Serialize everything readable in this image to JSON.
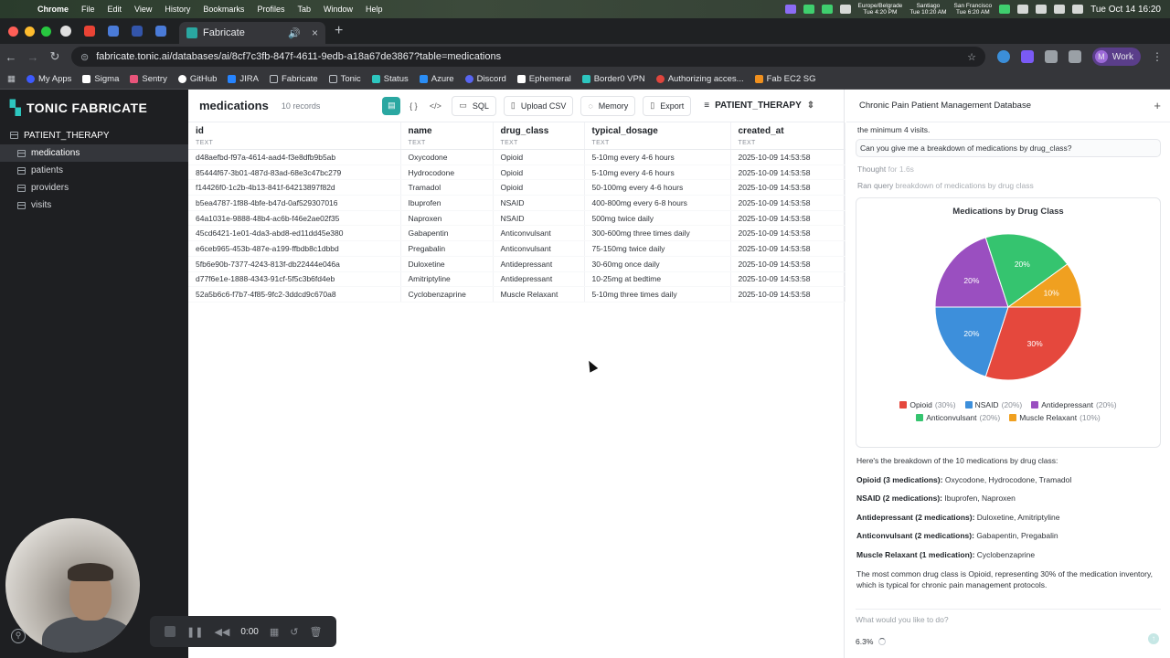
{
  "menubar": {
    "app": "Chrome",
    "items": [
      "File",
      "Edit",
      "View",
      "History",
      "Bookmarks",
      "Profiles",
      "Tab",
      "Window",
      "Help"
    ],
    "clocks": [
      {
        "city": "Europe/Belgrade",
        "time": "Tue 4:20 PM"
      },
      {
        "city": "Santiago",
        "time": "Tue 10:20 AM"
      },
      {
        "city": "San Francisco",
        "time": "Tue 6:20 AM"
      }
    ],
    "datetime": "Tue Oct 14  16:20"
  },
  "browser": {
    "active_tab": "Fabricate",
    "url": "fabricate.tonic.ai/databases/ai/8cf7c3fb-847f-4611-9edb-a18a67de3867?table=medications",
    "profile": "Work",
    "profile_initial": "M",
    "bookmarks": [
      "My Apps",
      "Sigma",
      "Sentry",
      "GitHub",
      "JIRA",
      "Fabricate",
      "Tonic",
      "Status",
      "Azure",
      "Discord",
      "Ephemeral",
      "Border0 VPN",
      "Authorizing acces...",
      "Fab EC2 SG"
    ]
  },
  "sidebar": {
    "brand": "TONIC FABRICATE",
    "database": "PATIENT_THERAPY",
    "tables": [
      {
        "label": "medications",
        "active": true
      },
      {
        "label": "patients",
        "active": false
      },
      {
        "label": "providers",
        "active": false
      },
      {
        "label": "visits",
        "active": false
      }
    ]
  },
  "toolbar": {
    "table_name": "medications",
    "record_count": "10 records",
    "sql": "SQL",
    "upload": "Upload CSV",
    "memory": "Memory",
    "export": "Export",
    "db_selector": "PATIENT_THERAPY"
  },
  "table": {
    "columns": [
      {
        "name": "id",
        "type": "TEXT"
      },
      {
        "name": "name",
        "type": "TEXT"
      },
      {
        "name": "drug_class",
        "type": "TEXT"
      },
      {
        "name": "typical_dosage",
        "type": "TEXT"
      },
      {
        "name": "created_at",
        "type": "TEXT"
      }
    ],
    "rows": [
      [
        "d48aefbd-f97a-4614-aad4-f3e8dfb9b5ab",
        "Oxycodone",
        "Opioid",
        "5-10mg every 4-6 hours",
        "2025-10-09 14:53:58"
      ],
      [
        "85444f67-3b01-487d-83ad-68e3c47bc279",
        "Hydrocodone",
        "Opioid",
        "5-10mg every 4-6 hours",
        "2025-10-09 14:53:58"
      ],
      [
        "f14426f0-1c2b-4b13-841f-64213897f82d",
        "Tramadol",
        "Opioid",
        "50-100mg every 4-6 hours",
        "2025-10-09 14:53:58"
      ],
      [
        "b5ea4787-1f88-4bfe-b47d-0af529307016",
        "Ibuprofen",
        "NSAID",
        "400-800mg every 6-8 hours",
        "2025-10-09 14:53:58"
      ],
      [
        "64a1031e-9888-48b4-ac6b-f46e2ae02f35",
        "Naproxen",
        "NSAID",
        "500mg twice daily",
        "2025-10-09 14:53:58"
      ],
      [
        "45cd6421-1e01-4da3-abd8-ed11dd45e380",
        "Gabapentin",
        "Anticonvulsant",
        "300-600mg three times daily",
        "2025-10-09 14:53:58"
      ],
      [
        "e6ceb965-453b-487e-a199-ffbdb8c1dbbd",
        "Pregabalin",
        "Anticonvulsant",
        "75-150mg twice daily",
        "2025-10-09 14:53:58"
      ],
      [
        "5fb6e90b-7377-4243-813f-db22444e046a",
        "Duloxetine",
        "Antidepressant",
        "30-60mg once daily",
        "2025-10-09 14:53:58"
      ],
      [
        "d77f6e1e-1888-4343-91cf-5f5c3b6fd4eb",
        "Amitriptyline",
        "Antidepressant",
        "10-25mg at bedtime",
        "2025-10-09 14:53:58"
      ],
      [
        "52a5b6c6-f7b7-4f85-9fc2-3ddcd9c670a8",
        "Cyclobenzaprine",
        "Muscle Relaxant",
        "5-10mg three times daily",
        "2025-10-09 14:53:58"
      ]
    ]
  },
  "chat": {
    "header": "Chronic Pain Patient Management Database",
    "prev_tail": "the minimum 4 visits.",
    "user_message": "Can you give me a breakdown of medications by drug_class?",
    "thought_label": "Thought",
    "thought_time": "for 1.6s",
    "ran_label": "Ran query",
    "ran_desc": "breakdown of medications by drug class",
    "answer_intro": "Here's the breakdown of the 10 medications by drug class:",
    "groups": [
      {
        "label": "Opioid (3 medications):",
        "items": "Oxycodone, Hydrocodone, Tramadol"
      },
      {
        "label": "NSAID (2 medications):",
        "items": "Ibuprofen, Naproxen"
      },
      {
        "label": "Antidepressant (2 medications):",
        "items": "Duloxetine, Amitriptyline"
      },
      {
        "label": "Anticonvulsant (2 medications):",
        "items": "Gabapentin, Pregabalin"
      },
      {
        "label": "Muscle Relaxant (1 medication):",
        "items": "Cyclobenzaprine"
      }
    ],
    "conclusion": "The most common drug class is Opioid, representing 30% of the medication inventory, which is typical for chronic pain management protocols.",
    "composer_placeholder": "What would you like to do?",
    "progress": "6.3%"
  },
  "chart_data": {
    "type": "pie",
    "title": "Medications by Drug Class",
    "slices": [
      {
        "label": "Opioid",
        "value": 30,
        "color": "#e5483d"
      },
      {
        "label": "NSAID",
        "value": 20,
        "color": "#3d8fdb"
      },
      {
        "label": "Antidepressant",
        "value": 20,
        "color": "#9a4fc0"
      },
      {
        "label": "Anticonvulsant",
        "value": 20,
        "color": "#35c46f"
      },
      {
        "label": "Muscle Relaxant",
        "value": 10,
        "color": "#f0a020"
      }
    ],
    "legend_pcts": [
      "(30%)",
      "(20%)",
      "(20%)",
      "(20%)",
      "(10%)"
    ],
    "slice_labels": [
      "30%",
      "20%",
      "20%",
      "20%",
      "10%"
    ],
    "legend": "bottom"
  },
  "recorder": {
    "time": "0:00"
  },
  "colors": {
    "accent": "#2aa7a1",
    "sidebar_bg": "#1e1f22"
  }
}
